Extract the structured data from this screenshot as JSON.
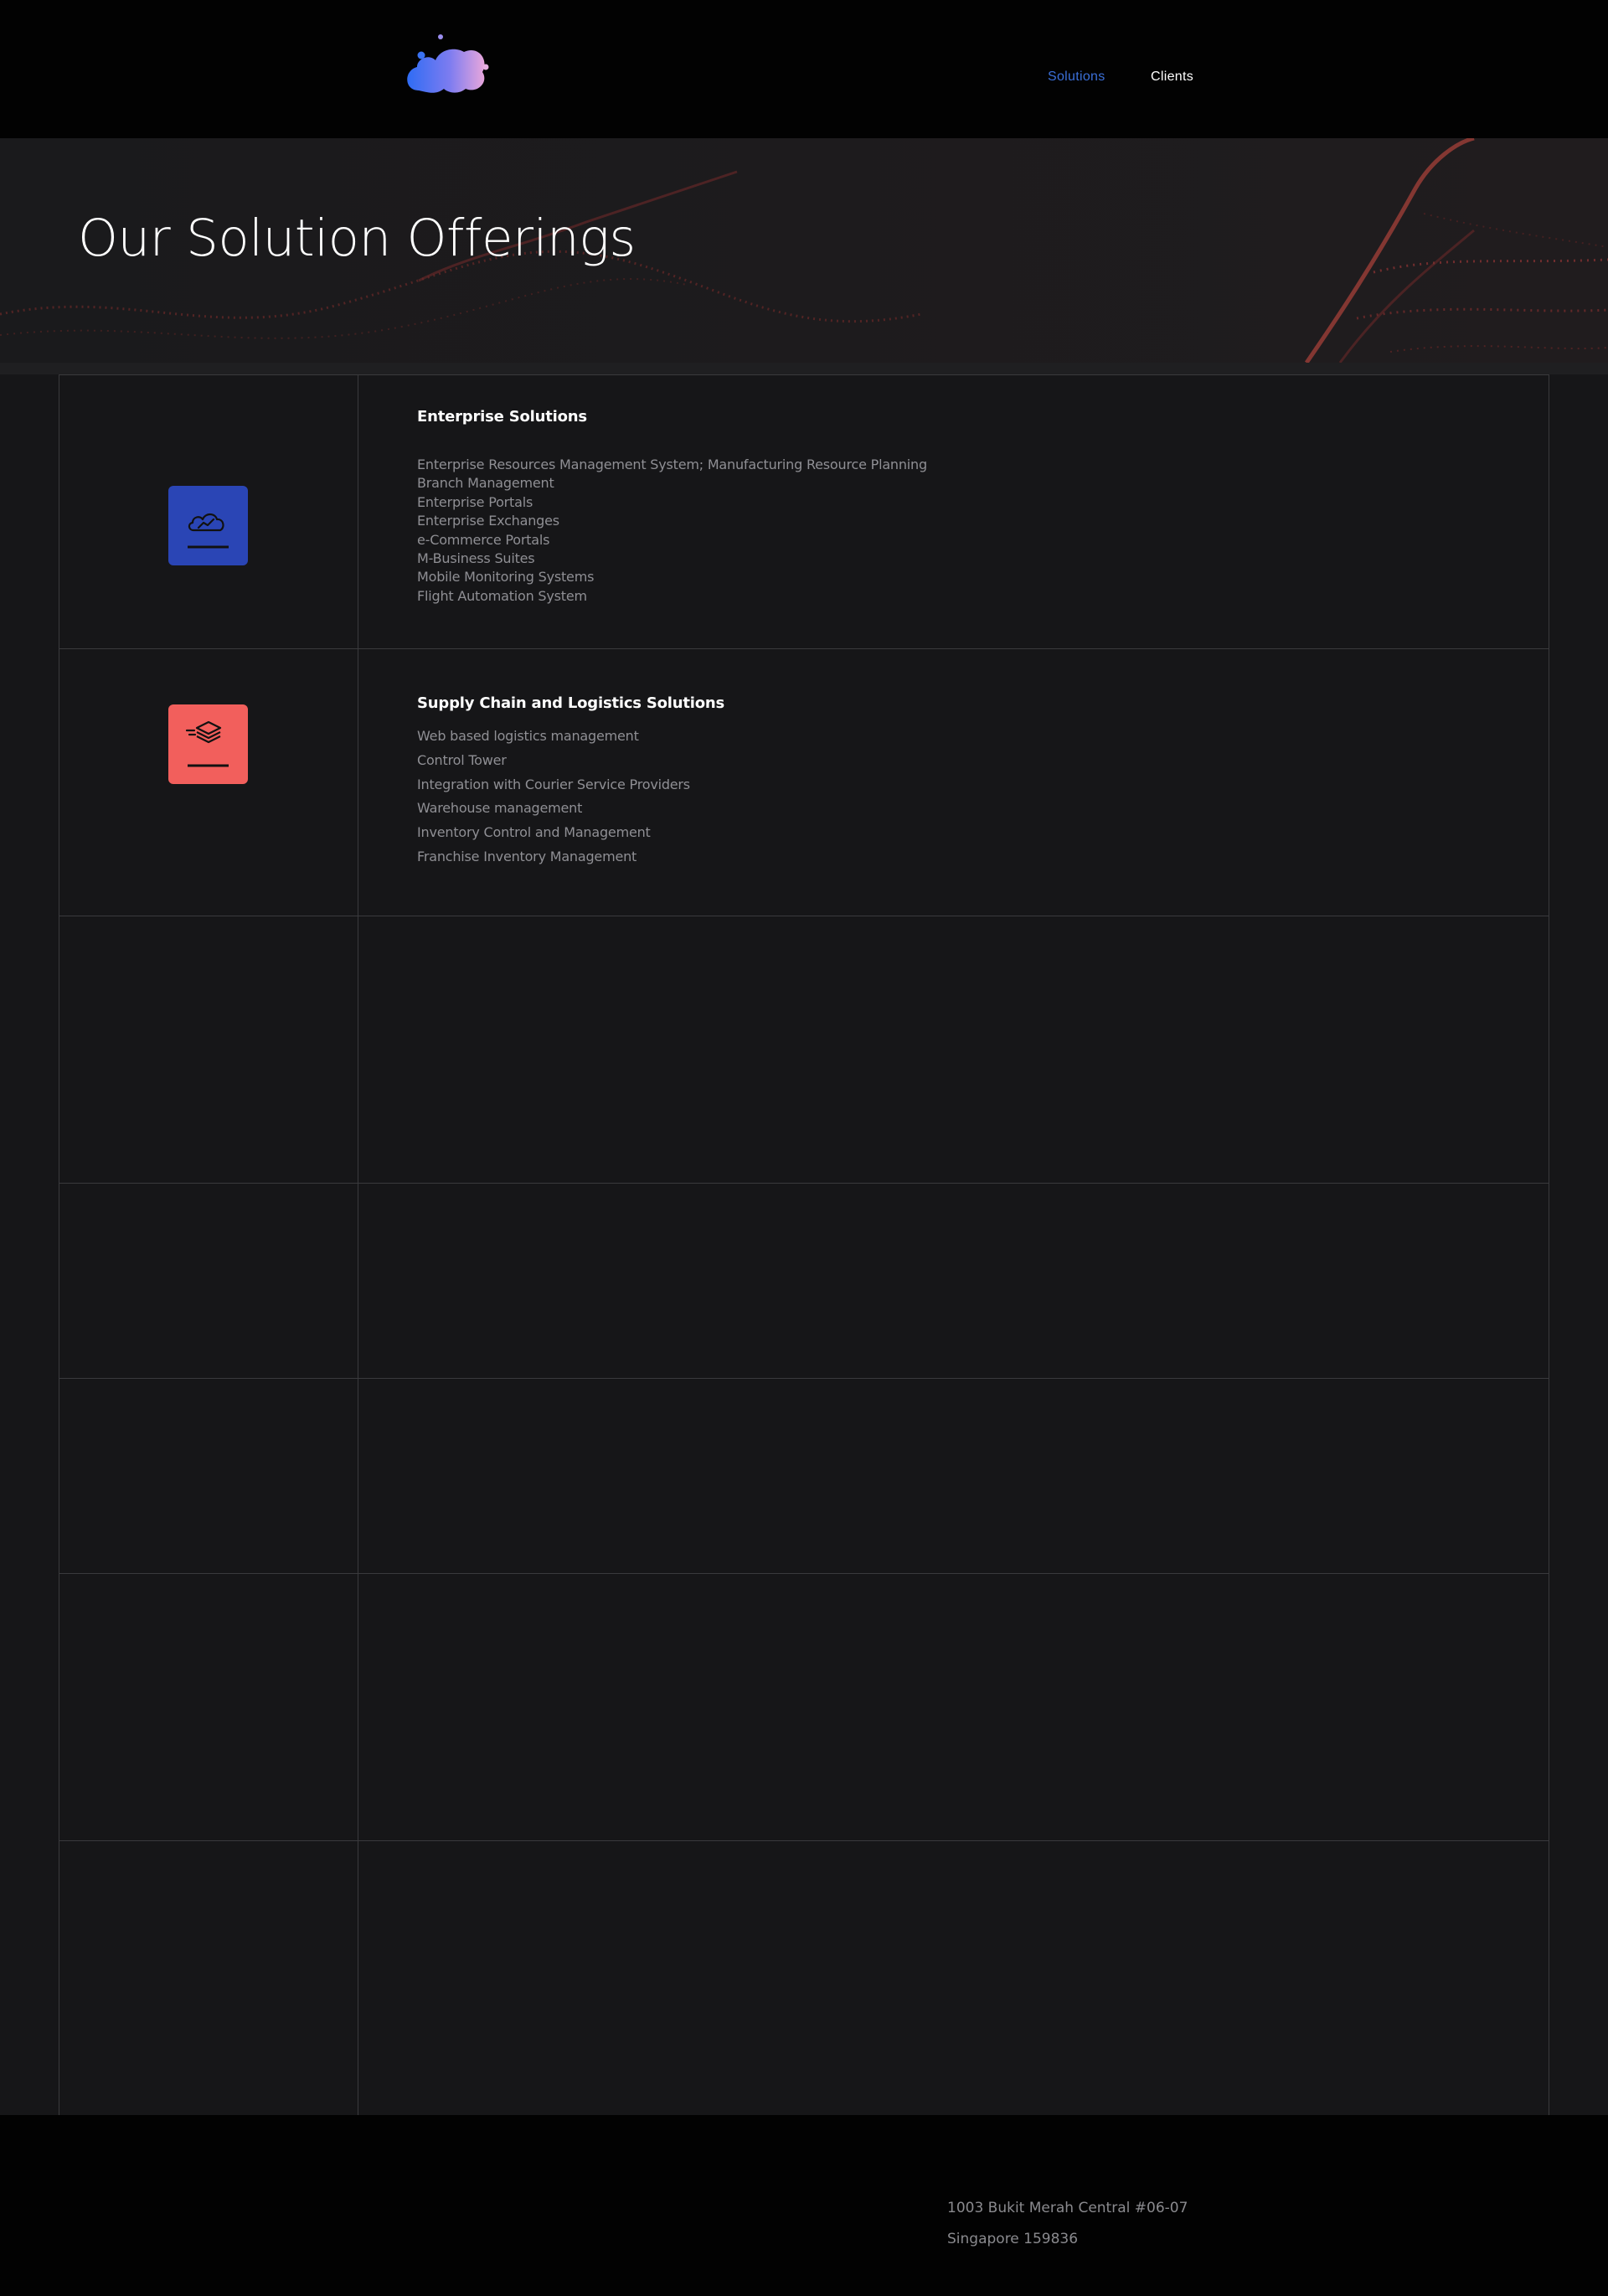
{
  "nav": {
    "logo_icon": "cloud-blob-logo",
    "links": [
      "Solutions",
      "Clients"
    ],
    "active_color": "#3b6fd8"
  },
  "hero": {
    "title": "Our Solution Offerings"
  },
  "sections": [
    {
      "title": "Enterprise Solutions",
      "icon": "cloud-chart-icon",
      "icon_bg": "#2a45b5",
      "items": [
        "Enterprise Resources Management System; Manufacturing Resource Planning",
        "Branch Management",
        "Enterprise Portals",
        "Enterprise Exchanges",
        "e-Commerce Portals",
        "M-Business Suites",
        "Mobile Monitoring Systems",
        "Flight Automation System"
      ]
    },
    {
      "title": "Supply Chain and Logistics Solutions",
      "icon": "layers-speed-icon",
      "icon_bg": "#f25f5c",
      "items": [
        "Web based logistics management",
        "Control Tower",
        "Integration with Courier Service Providers",
        "Warehouse management",
        "Inventory Control and Management",
        "Franchise Inventory Management"
      ]
    }
  ],
  "footer": {
    "address_line1": "1003 Bukit Merah Central #06-07",
    "address_line2": "Singapore 159836"
  }
}
